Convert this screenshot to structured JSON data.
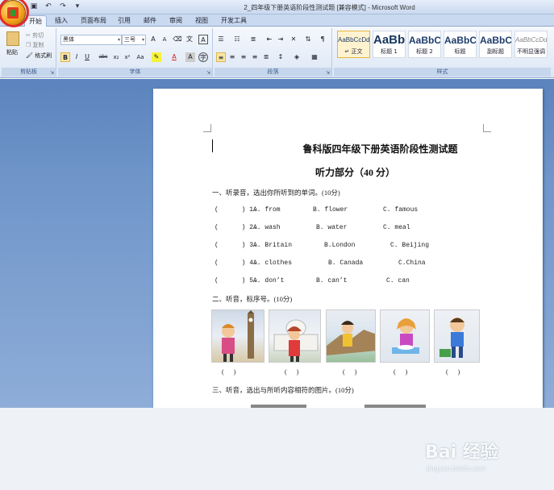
{
  "window": {
    "title": "2_四年级下册英语阶段性测试题 [兼容模式] - Microsoft Word",
    "qat": [
      "save-icon",
      "undo-icon",
      "redo-icon",
      "customize-icon"
    ]
  },
  "tabs": [
    "开始",
    "插入",
    "页面布局",
    "引用",
    "邮件",
    "审阅",
    "视图",
    "开发工具"
  ],
  "ribbon": {
    "clipboard": {
      "paste": "粘贴",
      "cut": "剪切",
      "copy": "复制",
      "format_painter": "格式刷",
      "label": "剪贴板"
    },
    "font": {
      "name": "黑体",
      "size": "三号",
      "label": "字体"
    },
    "paragraph": {
      "label": "段落"
    },
    "styles": {
      "label": "样式",
      "items": [
        {
          "sample": "AaBbCcDd",
          "name": "↵ 正文"
        },
        {
          "sample": "AaBb",
          "name": "标题 1"
        },
        {
          "sample": "AaBbC",
          "name": "标题 2"
        },
        {
          "sample": "AaBbC",
          "name": "标题"
        },
        {
          "sample": "AaBbC",
          "name": "副标题"
        },
        {
          "sample": "AaBbCcDd",
          "name": "不明显强调"
        }
      ]
    }
  },
  "document": {
    "title": "鲁科版四年级下册英语阶段性测试题",
    "subtitle": "听力部分（40 分）",
    "section1": "一、听录音，选出你所听到的单词。(10分)",
    "questions": [
      {
        "num": "(      ) 1.",
        "a": "A. from",
        "b": "B. flower",
        "c": "C. famous"
      },
      {
        "num": "(      ) 2.",
        "a": "A. wash",
        "b": "B. water",
        "c": "C. meal"
      },
      {
        "num": "(      ) 3.",
        "a": "A. Britain",
        "b": "B.London",
        "c": "C. Beijing"
      },
      {
        "num": "(      ) 4.",
        "a": "A. clothes",
        "b": "B. Canada",
        "c": "C.China"
      },
      {
        "num": "(      ) 5.",
        "a": "A. don’t",
        "b": "B. can’t",
        "c": "C. can"
      }
    ],
    "section2": "二、听音，标序号。(10分)",
    "parens": [
      "(      )",
      "(      )",
      "(      )",
      "(      )",
      "(      )"
    ],
    "section3": "三、听音，选出与所听内容相符的图片。(10分)"
  },
  "watermark": {
    "brand": "Bai 经验",
    "url": "jingyan.baidu.com"
  }
}
